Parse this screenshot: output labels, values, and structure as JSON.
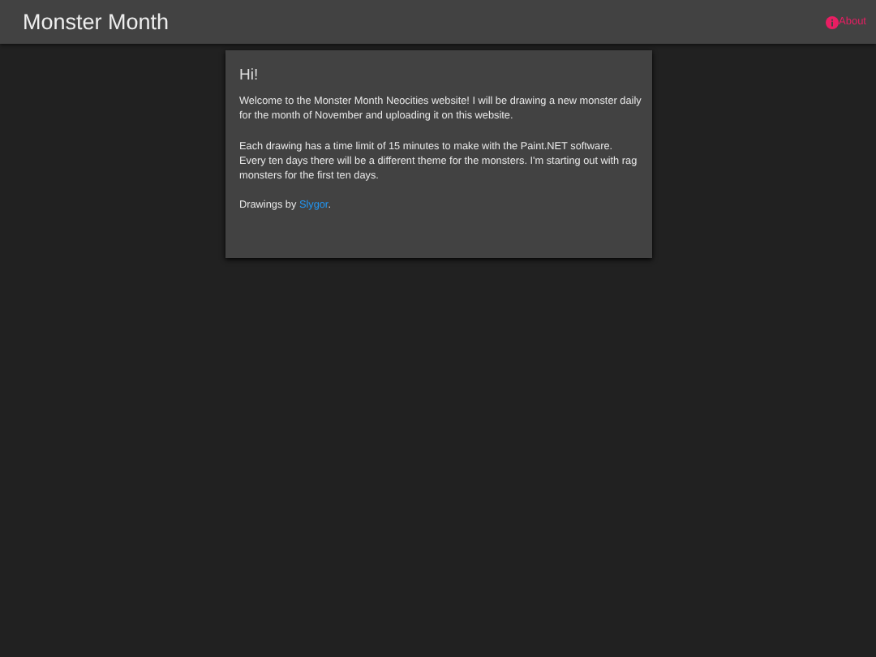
{
  "header": {
    "title": "Monster Month",
    "nav": [
      {
        "label": "About"
      }
    ]
  },
  "card": {
    "heading": "Hi!",
    "paragraphs": [
      "Welcome to the Monster Month Neocities website! I will be drawing a new monster daily for the month of November and uploading it on this website.",
      "Each drawing has a time limit of 15 minutes to make with the Paint.NET software. Every ten days there will be a different theme for the monsters. I'm starting out with rag monsters for the first ten days."
    ],
    "credits": {
      "prefix": "Drawings by ",
      "link": "Slygor",
      "suffix": "."
    }
  }
}
